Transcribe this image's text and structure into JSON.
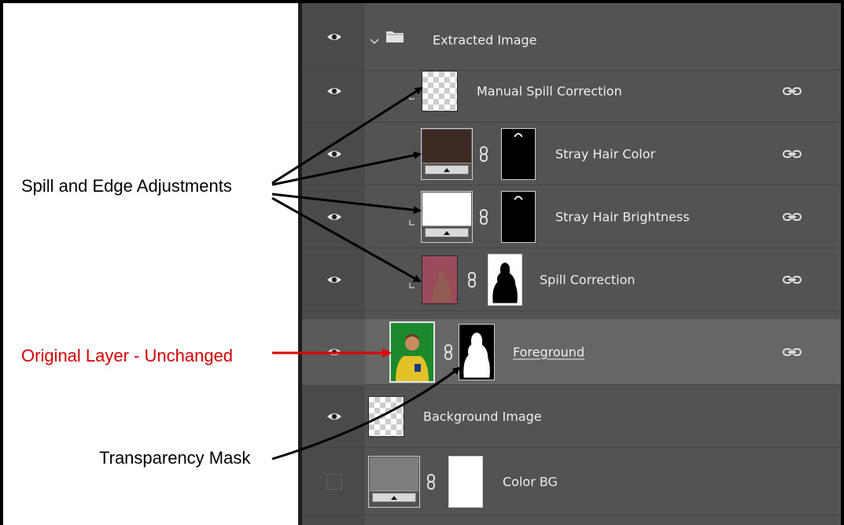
{
  "layers": {
    "group": {
      "name": "Extracted Image",
      "icon": "folder-icon",
      "expand_icon": "chevron-down-icon"
    },
    "items": [
      {
        "name": "Manual Spill Correction"
      },
      {
        "name": "Stray Hair Color"
      },
      {
        "name": "Stray Hair Brightness"
      },
      {
        "name": "Spill Correction"
      },
      {
        "name": "Foreground"
      },
      {
        "name": "Background Image"
      },
      {
        "name": "Color BG"
      }
    ]
  },
  "callouts": {
    "spill_edge": "Spill and Edge Adjustments",
    "original": "Original Layer - Unchanged",
    "transparency": "Transparency Mask"
  },
  "colors": {
    "panel_bg": "#535353",
    "selected_row": "#666666",
    "stray_hair_color_swatch": "#3e2a24",
    "spill_correction_swatch": "#9b4b5c",
    "callout_red": "#d40000"
  }
}
